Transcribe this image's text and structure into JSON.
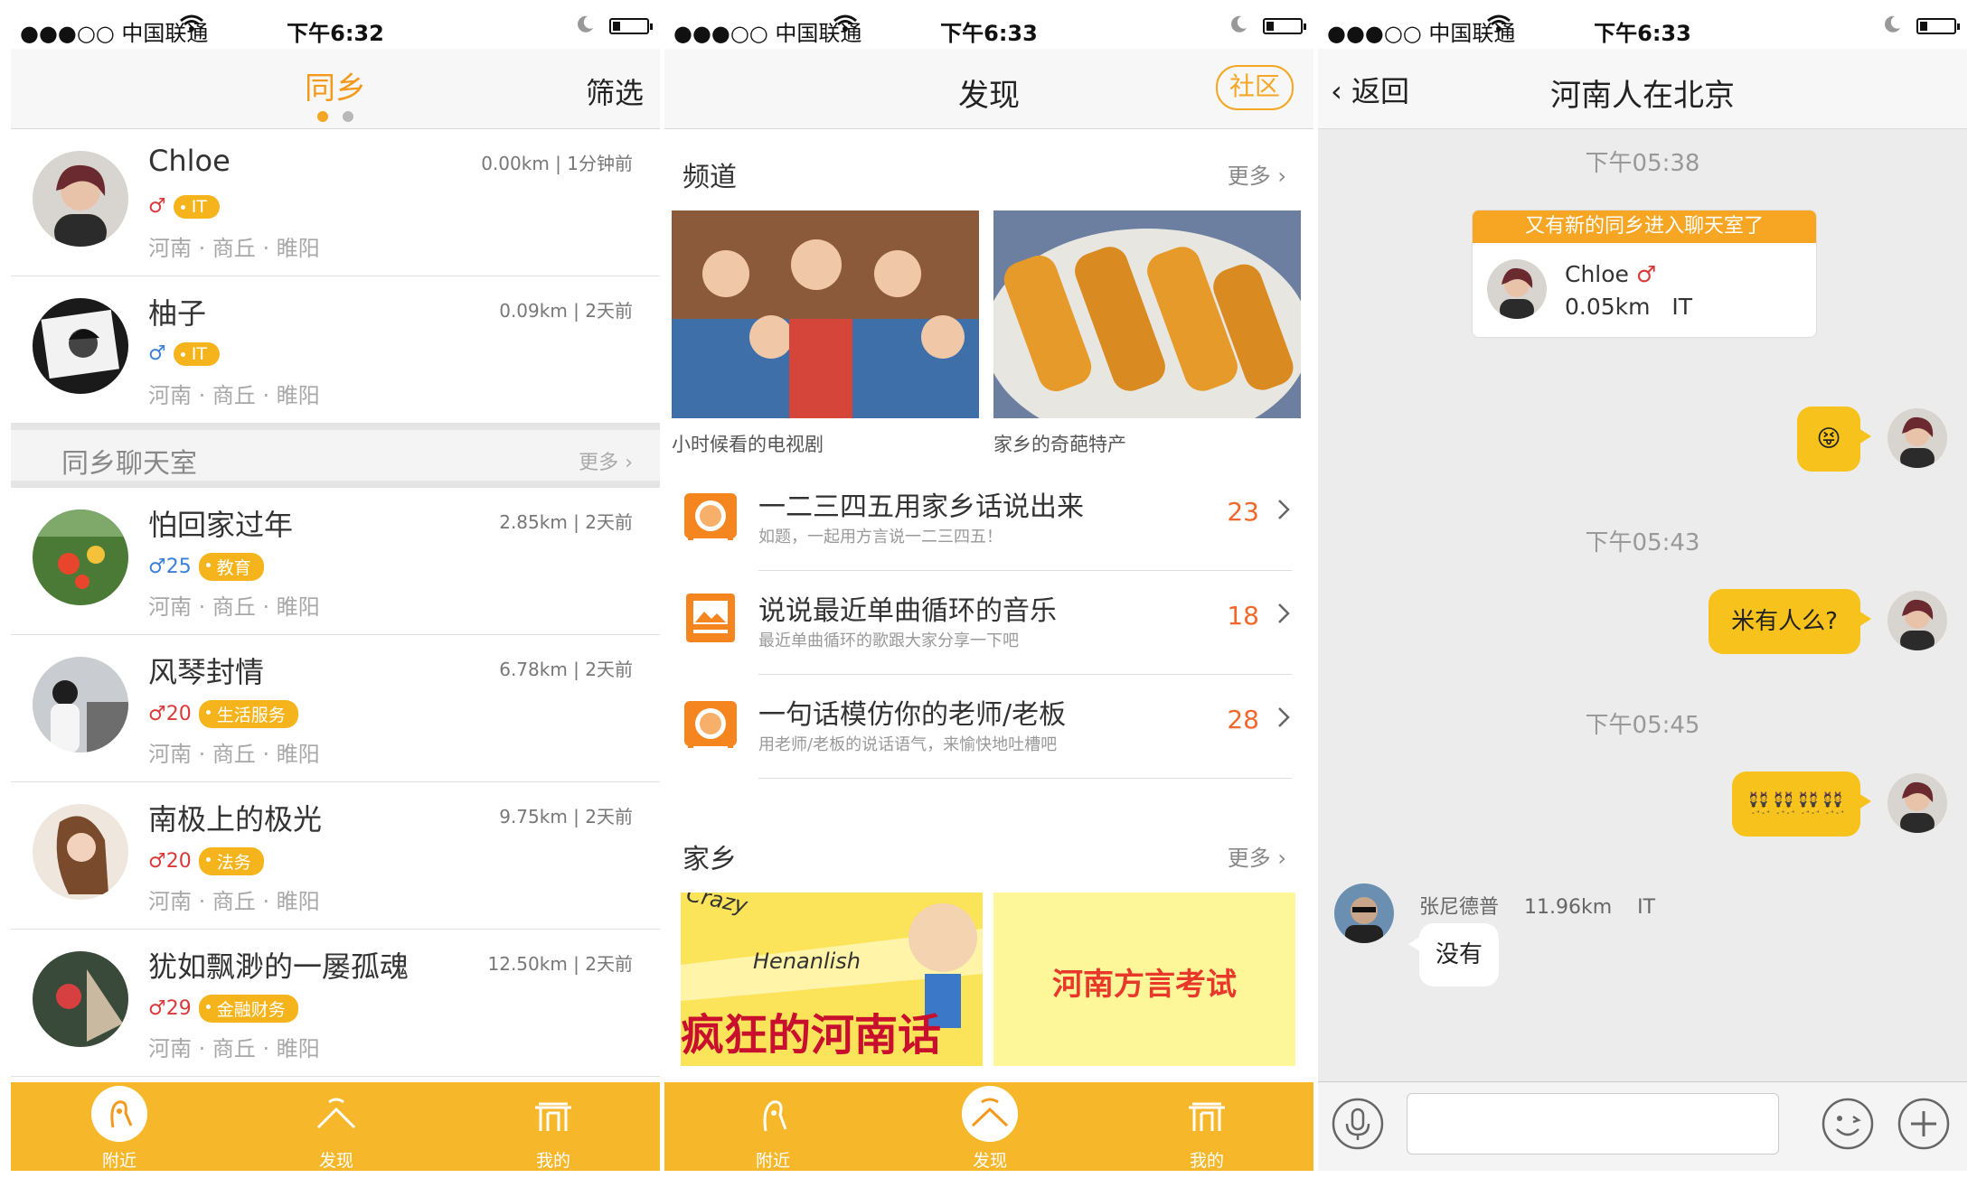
{
  "status_bars": [
    {
      "carrier": "●●●○○ 中国联通",
      "time": "下午6:32"
    },
    {
      "carrier": "●●●○○ 中国联通",
      "time": "下午6:33"
    },
    {
      "carrier": "●●●○○ 中国联通",
      "time": "下午6:33"
    }
  ],
  "nearby": {
    "title": "同乡",
    "filter_label": "筛选",
    "users_top": [
      {
        "name": "Chloe",
        "meta": "0.00km | 1分钟前",
        "gender": "♂",
        "age": "",
        "tag": "IT",
        "location": "河南 · 商丘 · 睢阳"
      },
      {
        "name": "柚子",
        "meta": "0.09km | 2天前",
        "gender": "♂",
        "age": "",
        "tag": "IT",
        "location": "河南 · 商丘 · 睢阳"
      }
    ],
    "chatroom_label": "同乡聊天室",
    "more_label": "更多",
    "users_bottom": [
      {
        "name": "怕回家过年",
        "meta": "2.85km | 2天前",
        "gender": "♂",
        "age": "25",
        "tag": "教育",
        "location": "河南 · 商丘 · 睢阳"
      },
      {
        "name": "风琴封情",
        "meta": "6.78km | 2天前",
        "gender": "♂",
        "age": "20",
        "tag": "生活服务",
        "location": "河南 · 商丘 · 睢阳"
      },
      {
        "name": "南极上的极光",
        "meta": "9.75km | 2天前",
        "gender": "♂",
        "age": "20",
        "tag": "法务",
        "location": "河南 · 商丘 · 睢阳"
      },
      {
        "name": "犹如飘渺的一屡孤魂",
        "meta": "12.50km | 2天前",
        "gender": "♂",
        "age": "29",
        "tag": "金融财务",
        "location": "河南 · 商丘 · 睢阳"
      }
    ]
  },
  "tabbar": {
    "nearby": "附近",
    "discover": "发现",
    "mine": "我的"
  },
  "discover": {
    "title": "发现",
    "community_label": "社区",
    "channels_title": "频道",
    "more_label": "更多",
    "channels": [
      {
        "caption": "小时候看的电视剧"
      },
      {
        "caption": "家乡的奇葩特产"
      }
    ],
    "topics": [
      {
        "title": "一二三四五用家乡话说出来",
        "subtitle": "如题，一起用方言说一二三四五！",
        "count": "23",
        "icon": "radio-icon"
      },
      {
        "title": "说说最近单曲循环的音乐",
        "subtitle": "最近单曲循环的歌跟大家分享一下吧",
        "count": "18",
        "icon": "picture-icon"
      },
      {
        "title": "一句话模仿你的老师/老板",
        "subtitle": "用老师/老板的说话语气，来愉快地吐槽吧",
        "count": "28",
        "icon": "radio-icon"
      }
    ],
    "hometown_title": "家乡",
    "hometown_cards": [
      {
        "line1": "Crazy",
        "line2": "Henanlish",
        "line3": "疯狂的河南话"
      },
      {
        "text": "河南方言考试"
      }
    ]
  },
  "chat": {
    "back_label": "返回",
    "title": "河南人在北京",
    "times": [
      "下午05:38",
      "下午05:43",
      "下午05:45"
    ],
    "notice": {
      "header": "又有新的同乡进入聊天室了",
      "name": "Chloe",
      "gender": "♂",
      "distance": "0.05km",
      "tag": "IT"
    },
    "messages": [
      {
        "side": "right",
        "text": "😝"
      },
      {
        "side": "right",
        "text": "米有人么?"
      },
      {
        "side": "right",
        "text": "👯👯👯👯"
      },
      {
        "side": "left",
        "sender": "张尼德普",
        "distance": "11.96km",
        "tag": "IT",
        "text": "没有"
      }
    ]
  },
  "colors": {
    "accent": "#f5a623",
    "tabbar": "#f6b72b",
    "count": "#f0682b"
  }
}
